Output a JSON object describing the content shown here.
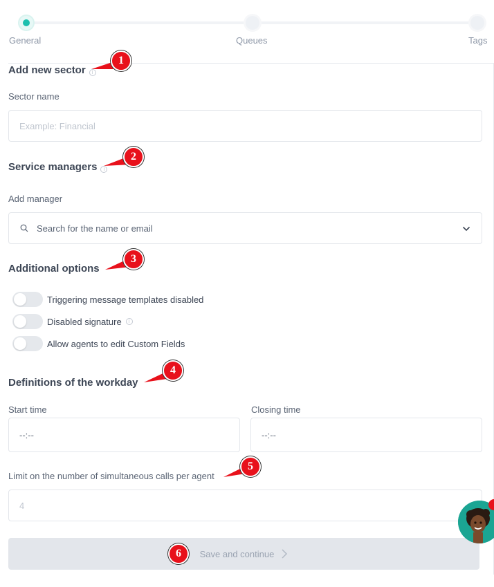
{
  "stepper": {
    "steps": [
      {
        "label": "General",
        "active": true
      },
      {
        "label": "Queues",
        "active": false
      },
      {
        "label": "Tags",
        "active": false
      }
    ]
  },
  "sector": {
    "heading": "Add new sector",
    "name_label": "Sector name",
    "name_placeholder": "Example: Financial"
  },
  "managers": {
    "heading": "Service managers",
    "add_label": "Add manager",
    "search_placeholder": "Search for the name or email"
  },
  "options": {
    "heading": "Additional options",
    "toggles": [
      {
        "label": "Triggering message templates disabled",
        "on": false
      },
      {
        "label": "Disabled signature",
        "on": false
      },
      {
        "label": "Allow agents to edit Custom Fields",
        "on": false
      }
    ]
  },
  "workday": {
    "heading": "Definitions of the workday",
    "start_label": "Start time",
    "start_value": "--:--",
    "closing_label": "Closing time",
    "closing_value": "--:--"
  },
  "limit": {
    "label": "Limit on the number of simultaneous calls per agent",
    "value": "4"
  },
  "save": {
    "label": "Save and continue"
  },
  "markers": [
    "1",
    "2",
    "3",
    "4",
    "5",
    "6"
  ],
  "colors": {
    "accent": "#1cbfae",
    "marker": "#e8111b",
    "button_bg": "#e3e6eb"
  }
}
